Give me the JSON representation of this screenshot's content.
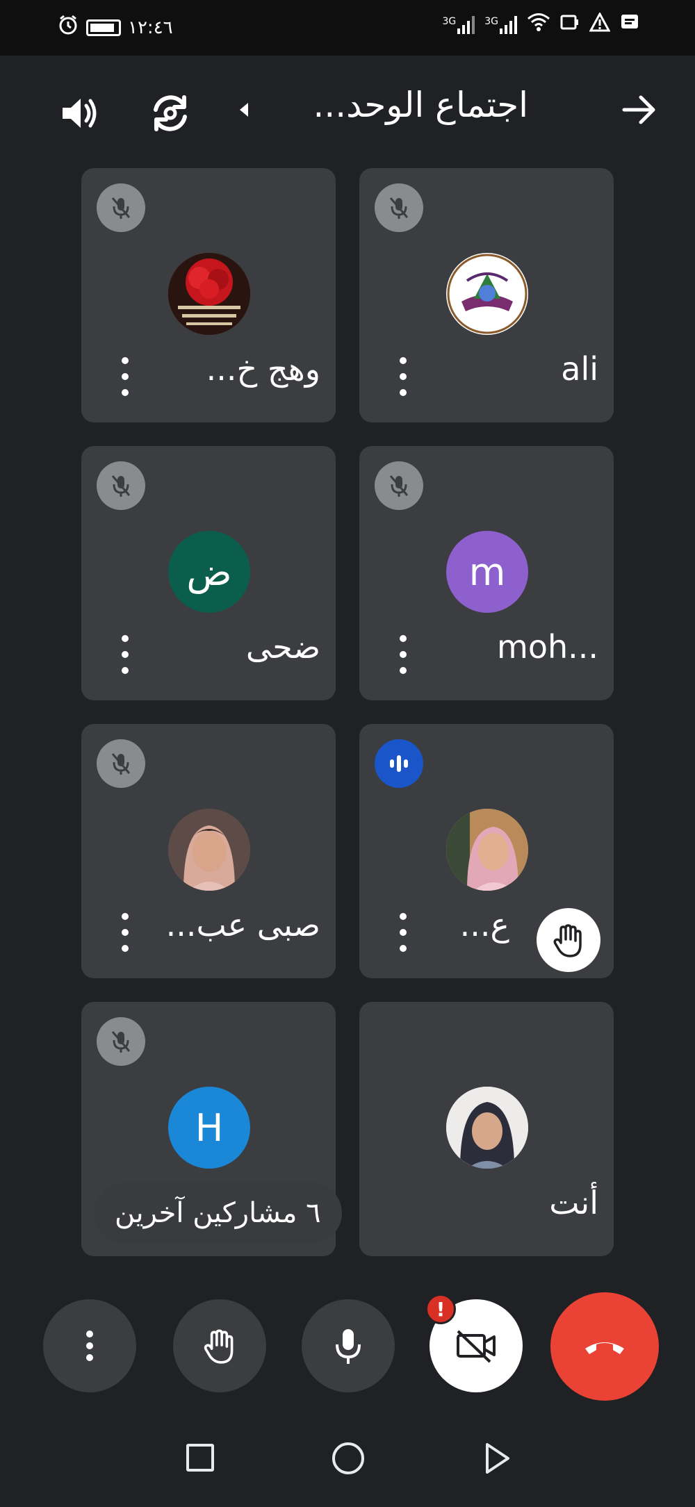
{
  "status_bar": {
    "time": "١٢:٤٦",
    "network_a": "3G",
    "network_b": "3G"
  },
  "header": {
    "meeting_title": "اجتماع الوحد..."
  },
  "participants": [
    {
      "name": "ali",
      "avatar_type": "logo",
      "muted": true
    },
    {
      "name": "وهج خ...",
      "avatar_type": "image-roses",
      "muted": true
    },
    {
      "name": "moh...",
      "avatar_letter": "m",
      "avatar_color": "#8e60cd",
      "muted": true
    },
    {
      "name": "ضحى",
      "avatar_letter": "ض",
      "avatar_color": "#0b5e4b",
      "muted": true
    },
    {
      "name": "ع...",
      "avatar_type": "photo-woman",
      "speaking": true,
      "hand_raised": true
    },
    {
      "name": "صبى عب...",
      "avatar_type": "photo-woman",
      "muted": true
    },
    {
      "name": "أنت",
      "avatar_type": "photo-woman"
    },
    {
      "avatar_letter": "H",
      "avatar_color": "#1a88d6",
      "muted": true
    }
  ],
  "others_chip": "٦ مشاركين آخرين",
  "colors": {
    "end_call": "#ea4335",
    "speaking": "#1a56c9",
    "tile": "#3c3d40"
  }
}
